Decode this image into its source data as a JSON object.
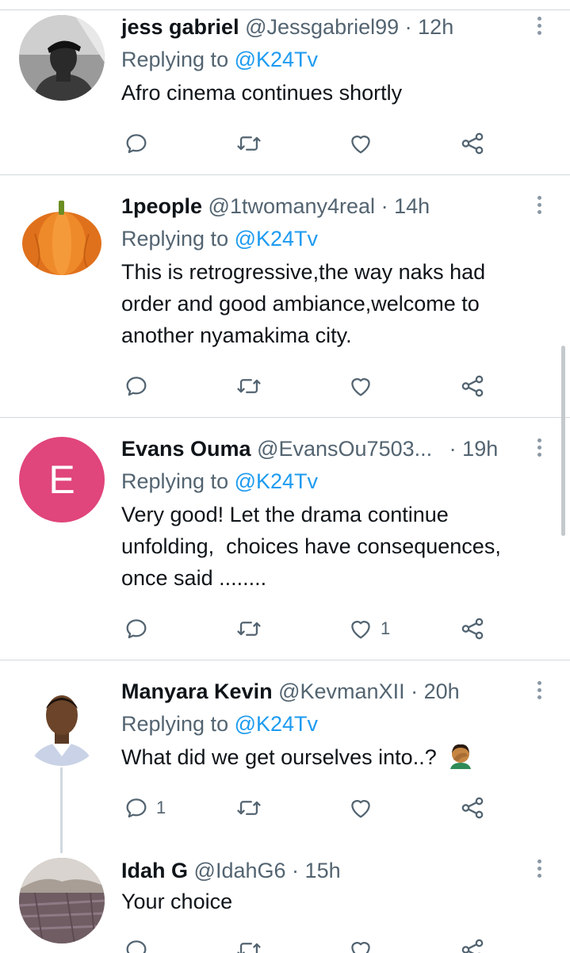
{
  "replying_prefix": "Replying to",
  "tweets": [
    {
      "name": "jess gabriel",
      "handle": "@Jessgabriel99",
      "dot": "·",
      "time": "12h",
      "reply_to": "@K24Tv",
      "text": "Afro cinema continues shortly",
      "likes": "",
      "replies": ""
    },
    {
      "name": "1people",
      "handle": "@1twomany4real",
      "dot": "·",
      "time": "14h",
      "reply_to": "@K24Tv",
      "text_lines": [
        "This is retrogressive,the way naks had",
        "order and good ambiance,welcome to",
        "another nyamakima city."
      ],
      "likes": "",
      "replies": ""
    },
    {
      "name": "Evans Ouma",
      "handle": "@EvansOu7503...",
      "dot": "·",
      "time": "19h",
      "avatar_letter": "E",
      "reply_to": "@K24Tv",
      "text_lines": [
        "Very good! Let the drama continue",
        "unfolding,  choices have consequences,",
        "once said ........"
      ],
      "likes": "1",
      "replies": ""
    },
    {
      "name": "Manyara Kevin",
      "handle": "@KevmanXII",
      "dot": "·",
      "time": "20h",
      "reply_to": "@K24Tv",
      "text": "What did we get ourselves into..?",
      "likes": "",
      "replies": "1"
    },
    {
      "name": "Idah G",
      "handle": "@IdahG6",
      "dot": "·",
      "time": "15h",
      "text": "Your choice",
      "likes": "",
      "replies": ""
    }
  ],
  "colors": {
    "accent": "#1d9bf0",
    "secondary_text": "#536471",
    "divider": "#cfd9de",
    "avatar_letter_bg": "#e0457b"
  },
  "icons": [
    "reply-icon",
    "retweet-icon",
    "like-icon",
    "share-icon",
    "more-icon",
    "face-palm-emoji"
  ]
}
